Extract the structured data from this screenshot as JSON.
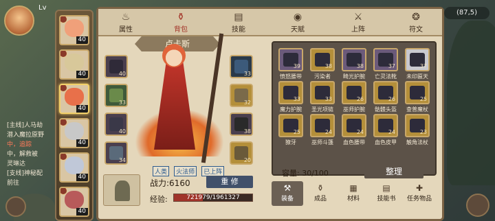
{
  "player": {
    "level_prefix": "Lv"
  },
  "coords": "(87,5)",
  "quests": {
    "line1": "[主线]人马劫",
    "line2": "潜入魔拉原野",
    "line3": "中，追踪",
    "line4": "中，解救被",
    "line5": "灵琳达",
    "line6": "[支线]神秘配",
    "line7": "前往",
    "line8": ""
  },
  "characters": [
    {
      "level": "40"
    },
    {
      "level": "40"
    },
    {
      "level": "40"
    },
    {
      "level": "40"
    },
    {
      "level": "40"
    },
    {
      "level": "40"
    }
  ],
  "tabs": [
    {
      "label": "属性",
      "icon": "flame-icon"
    },
    {
      "label": "背包",
      "icon": "bag-icon"
    },
    {
      "label": "技能",
      "icon": "book-icon"
    },
    {
      "label": "天赋",
      "icon": "eye-icon"
    },
    {
      "label": "上阵",
      "icon": "swords-icon"
    },
    {
      "label": "符文",
      "icon": "rune-icon"
    }
  ],
  "hero": {
    "name": "卢卡斯",
    "tags": [
      "人类",
      "火法师",
      "已上阵"
    ]
  },
  "equip_left": [
    {
      "lv": "40"
    },
    {
      "lv": "33"
    },
    {
      "lv": "40"
    },
    {
      "lv": "34"
    }
  ],
  "equip_right": [
    {
      "lv": "33"
    },
    {
      "lv": "32"
    },
    {
      "lv": "38"
    },
    {
      "lv": "20"
    }
  ],
  "power": {
    "label": "战力:",
    "value": "6160"
  },
  "repair_label": "重 修",
  "exp": {
    "label": "经验:",
    "text": "721979/1961327",
    "fraction": 0.368
  },
  "inventory": [
    {
      "name": "愤怒腰带",
      "lv": "39"
    },
    {
      "name": "污染者",
      "lv": "38"
    },
    {
      "name": "畸光护腕",
      "lv": "38"
    },
    {
      "name": "亡灵法靴",
      "lv": "37"
    },
    {
      "name": "未印匾天",
      "lv": "37"
    },
    {
      "name": "魔力护腕",
      "lv": "33"
    },
    {
      "name": "圣光项链",
      "lv": "33"
    },
    {
      "name": "巫师护腕",
      "lv": "26"
    },
    {
      "name": "骷髅头盔",
      "lv": "26"
    },
    {
      "name": "查普魔杖",
      "lv": "25"
    },
    {
      "name": "獠牙",
      "lv": "25"
    },
    {
      "name": "巫师斗篷",
      "lv": "24"
    },
    {
      "name": "血色腰带",
      "lv": "24"
    },
    {
      "name": "血色皮甲",
      "lv": "24"
    },
    {
      "name": "触角法杖",
      "lv": "23"
    }
  ],
  "capacity": {
    "label": "容量:",
    "value": "30/100"
  },
  "sort_label": "整理",
  "bottom_tabs": [
    {
      "label": "装备",
      "icon": "hammer-icon"
    },
    {
      "label": "成品",
      "icon": "vase-icon"
    },
    {
      "label": "材料",
      "icon": "crate-icon"
    },
    {
      "label": "技能书",
      "icon": "scroll-icon"
    },
    {
      "label": "任务物品",
      "icon": "pouch-icon"
    }
  ]
}
